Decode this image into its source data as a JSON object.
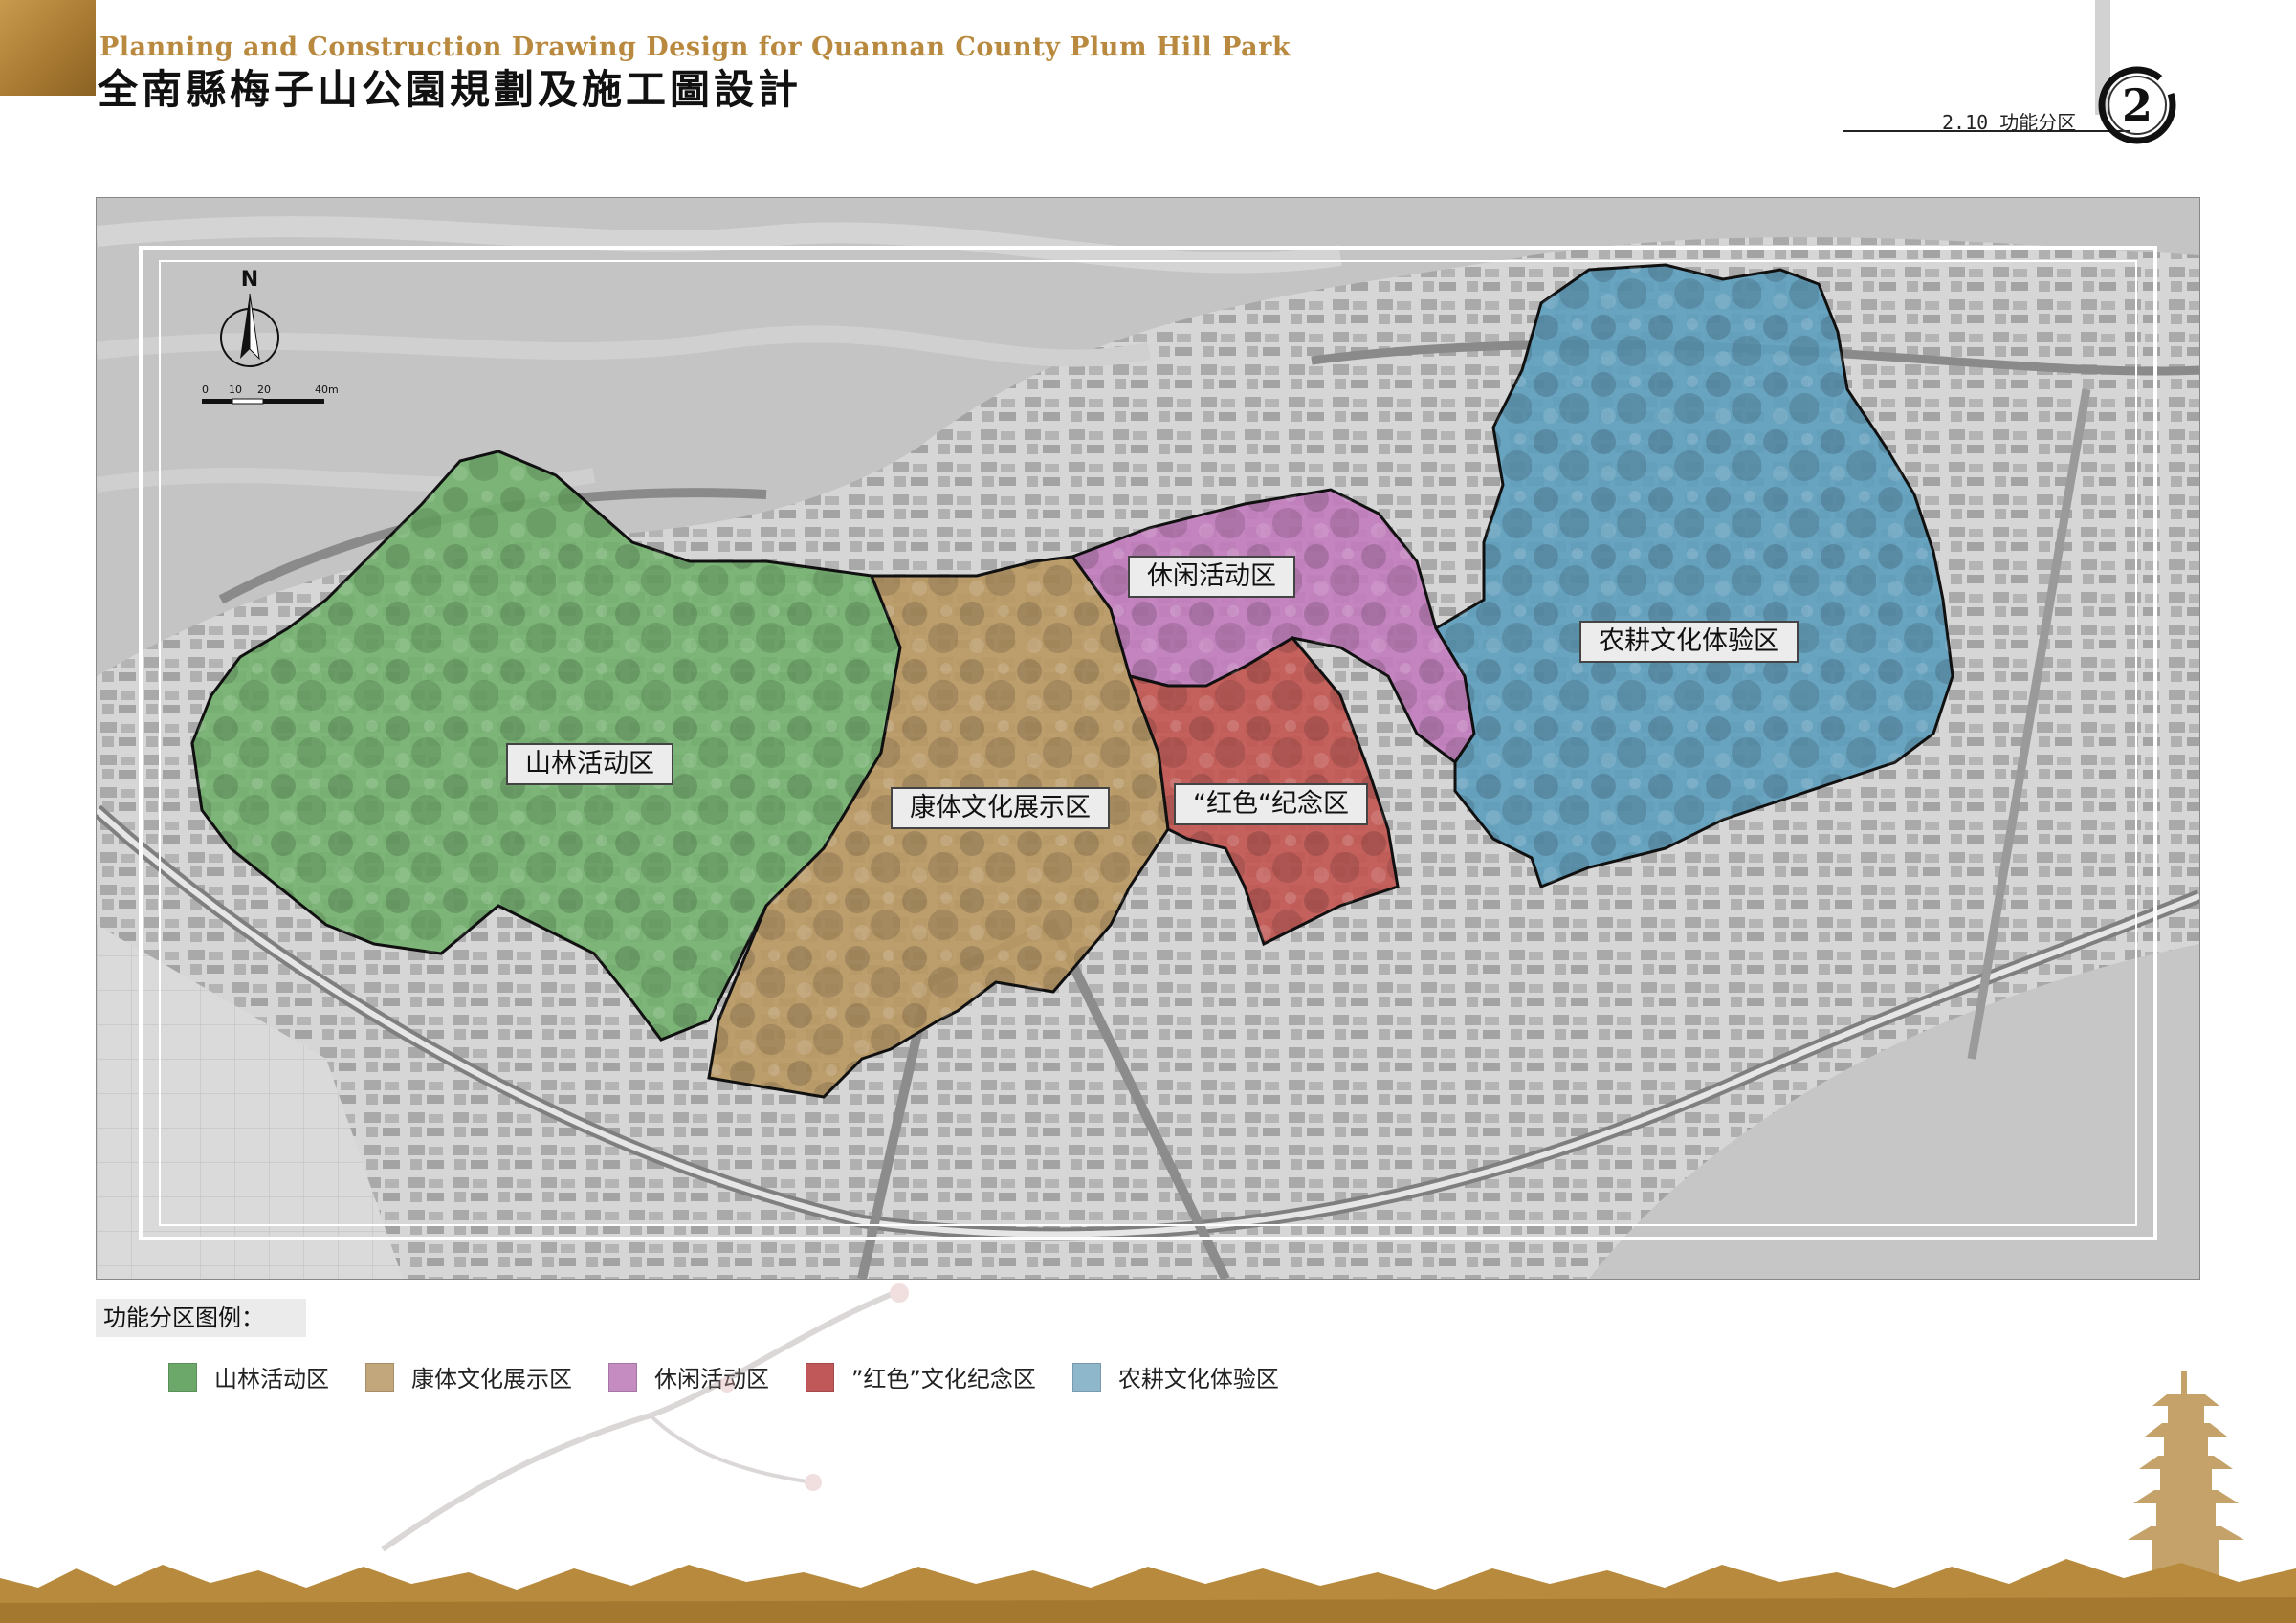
{
  "header": {
    "title_en": "Planning and Construction Drawing Design for Quannan County Plum Hill Park",
    "title_cn": "全南縣梅子山公園規劃及施工圖設計",
    "section": "2.10 功能分区",
    "page_badge": "2"
  },
  "map": {
    "north_label": "N",
    "scale_labels": [
      "0",
      "10",
      "20",
      "40m"
    ],
    "zones": [
      {
        "label": "山林活动区",
        "color": "#6fb06a"
      },
      {
        "label": "康体文化展示区",
        "color": "#b99760"
      },
      {
        "label": "休闲活动区",
        "color": "#c27bbd"
      },
      {
        "label": "“红色“纪念区",
        "color": "#c25450"
      },
      {
        "label": "农耕文化体验区",
        "color": "#5c9dbd"
      }
    ]
  },
  "legend": {
    "title": "功能分区图例：",
    "items": [
      {
        "label": "山林活动区",
        "color": "#6ca86a"
      },
      {
        "label": "康体文化展示区",
        "color": "#c2a77c"
      },
      {
        "label": "休闲活动区",
        "color": "#c48cc1"
      },
      {
        "label": "”红色”文化纪念区",
        "color": "#c0585a"
      },
      {
        "label": "农耕文化体验区",
        "color": "#8eb7cc"
      }
    ]
  }
}
